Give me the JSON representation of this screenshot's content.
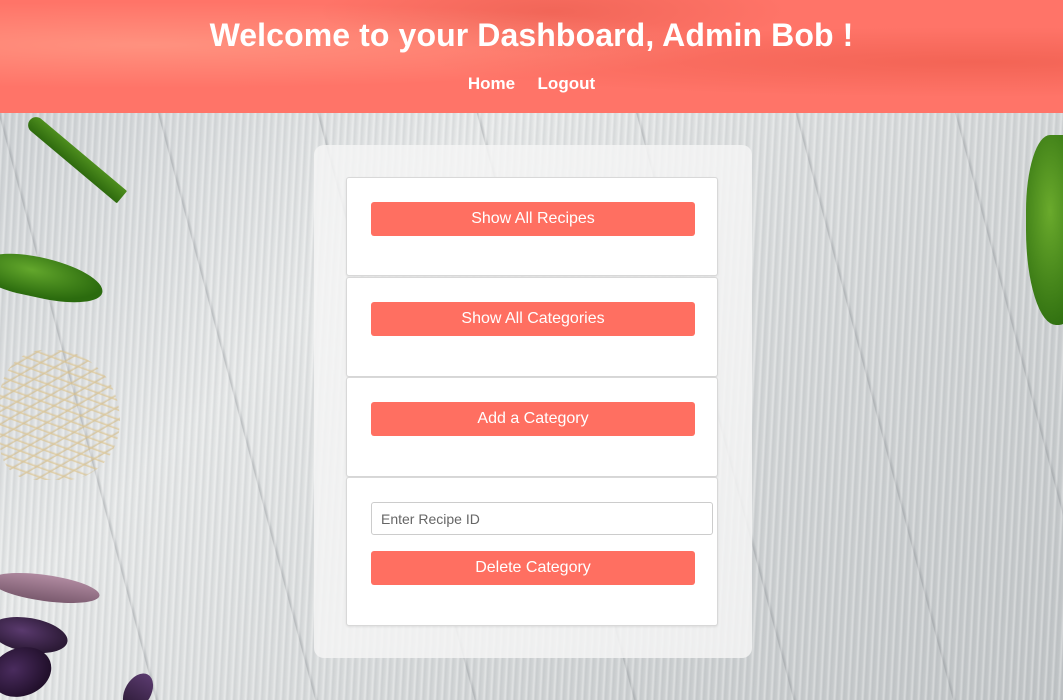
{
  "header": {
    "title": "Welcome to your Dashboard, Admin Bob !",
    "nav": {
      "home": "Home",
      "logout": "Logout"
    }
  },
  "dashboard": {
    "show_all_recipes": "Show All Recipes",
    "show_all_categories": "Show All Categories",
    "add_category": "Add a Category",
    "recipe_id_input": {
      "placeholder": "Enter Recipe ID",
      "value": ""
    },
    "delete_category": "Delete Category"
  },
  "colors": {
    "header_bg": "#ff7468",
    "button_bg": "#ff6f61",
    "button_text": "#ffffff",
    "panel_bg": "#f5f5f5"
  }
}
